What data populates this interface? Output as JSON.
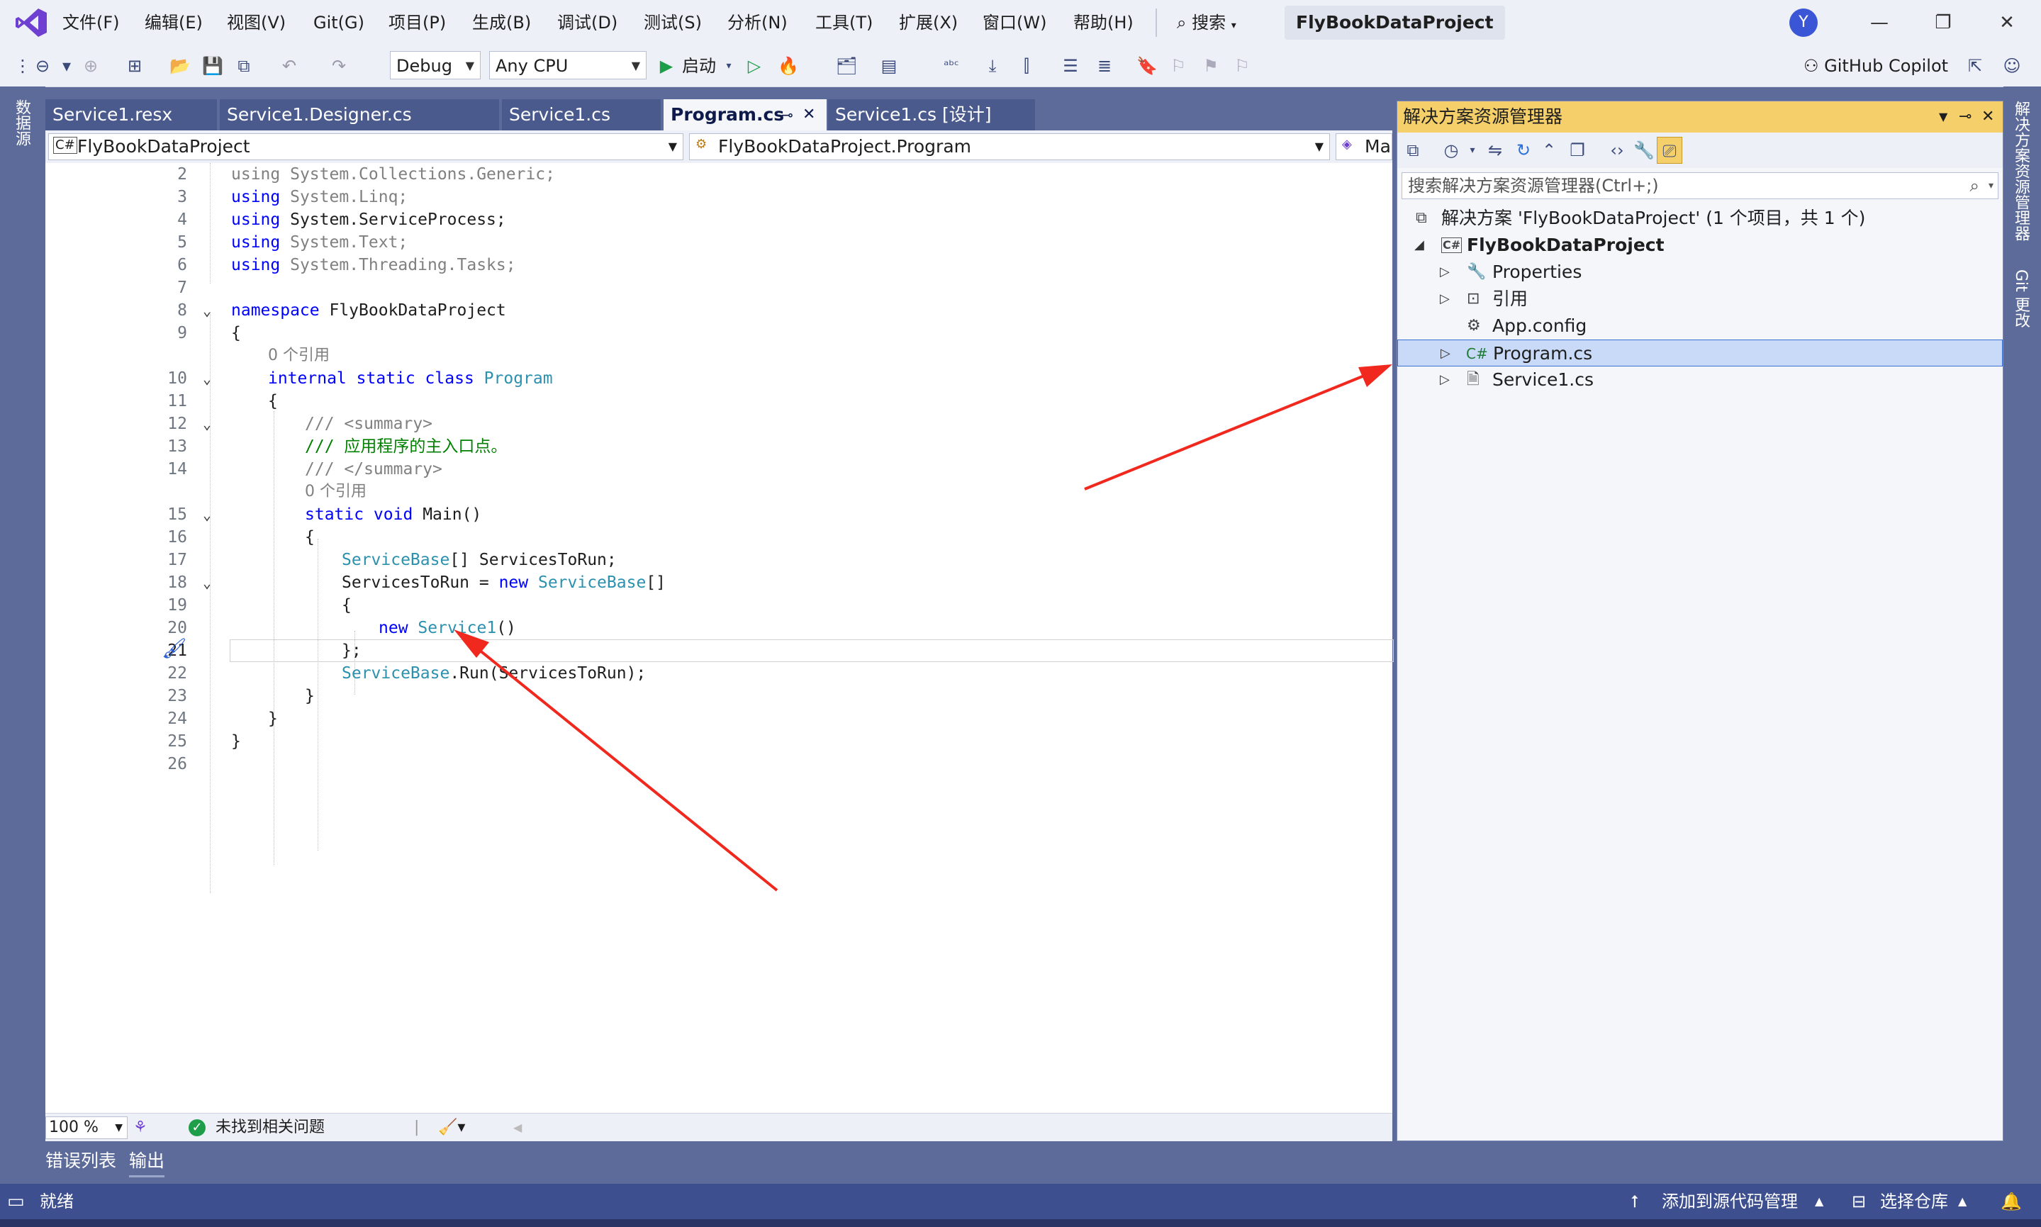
{
  "menubar": {
    "items": [
      "文件(F)",
      "编辑(E)",
      "视图(V)",
      "Git(G)",
      "项目(P)",
      "生成(B)",
      "调试(D)",
      "测试(S)",
      "分析(N)",
      "工具(T)",
      "扩展(X)",
      "窗口(W)",
      "帮助(H)"
    ],
    "search_label": "搜索",
    "project_name": "FlyBookDataProject",
    "avatar_letter": "Y"
  },
  "toolbar": {
    "configuration": "Debug",
    "platform": "Any CPU",
    "run_label": "启动",
    "copilot_label": "GitHub Copilot"
  },
  "left_strip": {
    "label": "数据源"
  },
  "right_strip": {
    "label_top": "解决方案资源管理器",
    "label_bottom": "Git 更改"
  },
  "tabs": [
    {
      "label": "Service1.resx"
    },
    {
      "label": "Service1.Designer.cs"
    },
    {
      "label": "Service1.cs"
    },
    {
      "label": "Program.cs"
    },
    {
      "label": "Service1.cs [设计]"
    }
  ],
  "navbar": {
    "project": "FlyBookDataProject",
    "class": "FlyBookDataProject.Program",
    "member": "Mai"
  },
  "editor": {
    "lines": [
      {
        "n": "2",
        "code": "using System.Collections.Generic;"
      },
      {
        "n": "3",
        "code": "using System.Linq;"
      },
      {
        "n": "4",
        "code": "using System.ServiceProcess;"
      },
      {
        "n": "5",
        "code": "using System.Text;"
      },
      {
        "n": "6",
        "code": "using System.Threading.Tasks;"
      },
      {
        "n": "7",
        "code": ""
      },
      {
        "n": "8",
        "code": "namespace FlyBookDataProject"
      },
      {
        "n": "9",
        "code": "{"
      },
      {
        "n": "",
        "code": "0 个引用"
      },
      {
        "n": "10",
        "code": "internal static class Program"
      },
      {
        "n": "11",
        "code": "{"
      },
      {
        "n": "12",
        "code": "/// <summary>"
      },
      {
        "n": "13",
        "code": "/// 应用程序的主入口点。"
      },
      {
        "n": "14",
        "code": "/// </summary>"
      },
      {
        "n": "",
        "code": "0 个引用"
      },
      {
        "n": "15",
        "code": "static void Main()"
      },
      {
        "n": "16",
        "code": "{"
      },
      {
        "n": "17",
        "code": "ServiceBase[] ServicesToRun;"
      },
      {
        "n": "18",
        "code": "ServicesToRun = new ServiceBase[]"
      },
      {
        "n": "19",
        "code": "{"
      },
      {
        "n": "20",
        "code": "new Service1()"
      },
      {
        "n": "21",
        "code": "};"
      },
      {
        "n": "22",
        "code": "ServiceBase.Run(ServicesToRun);"
      },
      {
        "n": "23",
        "code": "}"
      },
      {
        "n": "24",
        "code": "}"
      },
      {
        "n": "25",
        "code": "}"
      },
      {
        "n": "26",
        "code": ""
      }
    ]
  },
  "editor_status": {
    "zoom": "100 %",
    "issues": "未找到相关问题"
  },
  "solution_explorer": {
    "title": "解决方案资源管理器",
    "search_placeholder": "搜索解决方案资源管理器(Ctrl+;)",
    "solution": "解决方案 'FlyBookDataProject' (1 个项目，共 1 个)",
    "project": "FlyBookDataProject",
    "items": [
      "Properties",
      "引用",
      "App.config",
      "Program.cs",
      "Service1.cs"
    ],
    "selected": "Program.cs"
  },
  "bottom_tabs": [
    "错误列表",
    "输出"
  ],
  "statusbar": {
    "ready": "就绪",
    "source_control": "添加到源代码管理",
    "repo": "选择仓库"
  },
  "colors": {
    "accent": "#5c6b99",
    "title_bar": "#f5cf6a",
    "selection": "#c9daf8",
    "arrow": "#f0281e"
  }
}
